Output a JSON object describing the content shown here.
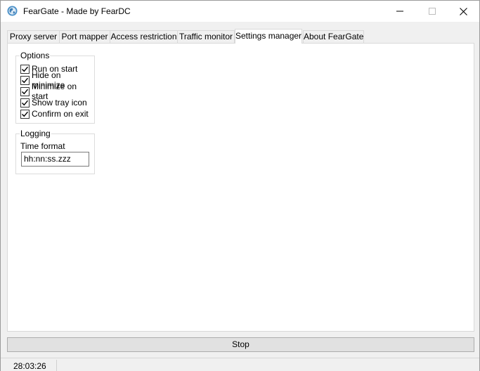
{
  "window": {
    "title": "FearGate - Made by FearDC",
    "icon": "globe-icon",
    "controls": [
      "minimize-icon",
      "maximize-icon",
      "close-icon"
    ]
  },
  "tabs": [
    {
      "label": "Proxy server",
      "active": false
    },
    {
      "label": "Port mapper",
      "active": false
    },
    {
      "label": "Access restriction",
      "active": false
    },
    {
      "label": "Traffic monitor",
      "active": false
    },
    {
      "label": "Settings manager",
      "active": true
    },
    {
      "label": "About FearGate",
      "active": false
    }
  ],
  "options": {
    "legend": "Options",
    "items": [
      {
        "label": "Run on start",
        "checked": true
      },
      {
        "label": "Hide on minimize",
        "checked": true
      },
      {
        "label": "Minimize on start",
        "checked": true
      },
      {
        "label": "Show tray icon",
        "checked": true
      },
      {
        "label": "Confirm on exit",
        "checked": true
      }
    ]
  },
  "logging": {
    "legend": "Logging",
    "time_format_label": "Time format",
    "time_format_value": "hh:nn:ss.zzz"
  },
  "actions": {
    "stop_label": "Stop"
  },
  "status": {
    "time": "28:03:26"
  }
}
